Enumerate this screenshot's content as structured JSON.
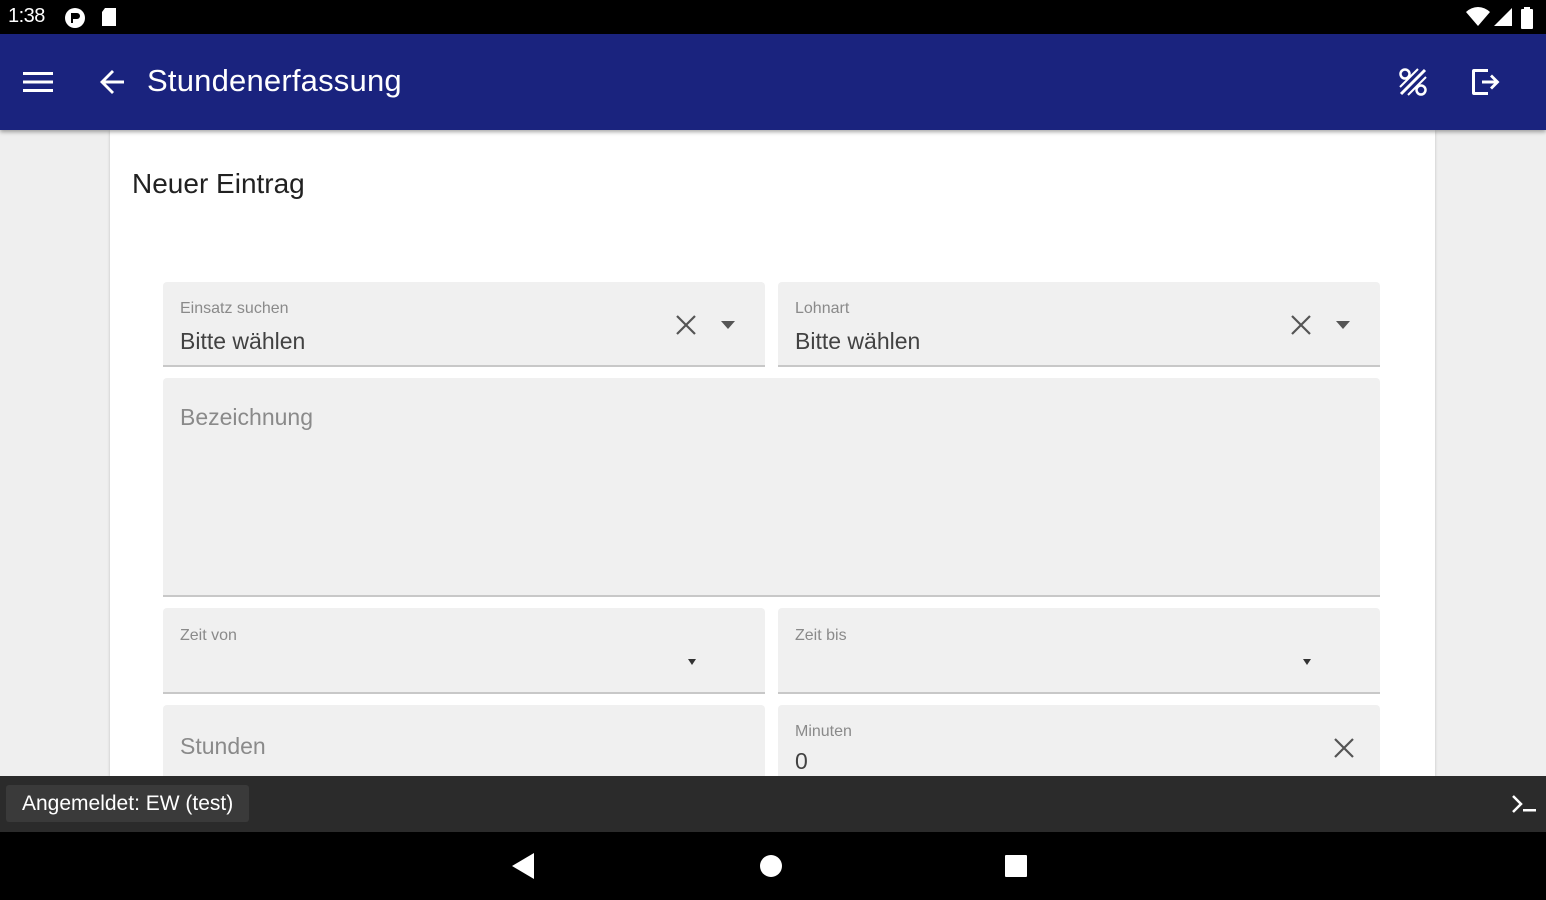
{
  "status_bar": {
    "time": "1:38",
    "icons": [
      "app-notification-icon",
      "sd-card-icon",
      "wifi-icon",
      "signal-icon",
      "battery-icon"
    ]
  },
  "app_bar": {
    "title": "Stundenerfassung",
    "background": "#1a237e",
    "icons": [
      "menu-icon",
      "back-arrow-icon",
      "percent-icon",
      "logout-icon"
    ]
  },
  "form": {
    "title": "Neuer Eintrag",
    "einsatz": {
      "label": "Einsatz suchen",
      "value": "Bitte wählen"
    },
    "lohnart": {
      "label": "Lohnart",
      "value": "Bitte wählen"
    },
    "bezeichnung": {
      "placeholder": "Bezeichnung"
    },
    "zeit_von": {
      "label": "Zeit von"
    },
    "zeit_bis": {
      "label": "Zeit bis"
    },
    "stunden": {
      "placeholder": "Stunden"
    },
    "minuten": {
      "label": "Minuten",
      "value": "0"
    }
  },
  "bottom_bar": {
    "login_status": "Angemeldet: EW (test)"
  },
  "nav_bar": {
    "buttons": [
      "back-triangle-icon",
      "home-circle-icon",
      "recents-square-icon"
    ]
  }
}
